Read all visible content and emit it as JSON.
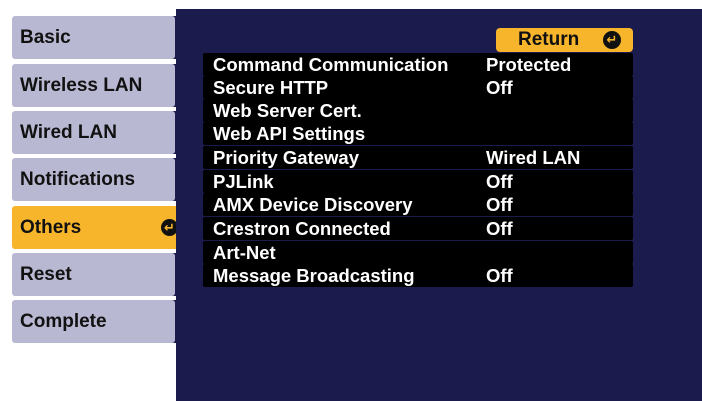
{
  "sidebar": {
    "items": [
      {
        "label": "Basic"
      },
      {
        "label": "Wireless LAN"
      },
      {
        "label": "Wired LAN"
      },
      {
        "label": "Notifications"
      },
      {
        "label": "Others",
        "active": true
      },
      {
        "label": "Reset"
      },
      {
        "label": "Complete"
      }
    ]
  },
  "main": {
    "return_label": "Return",
    "settings": [
      {
        "label": "Command Communication",
        "value": "Protected"
      },
      {
        "label": "Secure HTTP",
        "value": "Off"
      },
      {
        "label": "Web Server Cert.",
        "value": ""
      },
      {
        "label": "Web API Settings",
        "value": ""
      },
      {
        "label": "Priority Gateway",
        "value": "Wired LAN"
      },
      {
        "label": "PJLink",
        "value": "Off"
      },
      {
        "label": "AMX Device Discovery",
        "value": "Off"
      },
      {
        "label": "Crestron Connected",
        "value": "Off"
      },
      {
        "label": "Art-Net",
        "value": ""
      },
      {
        "label": "Message Broadcasting",
        "value": "Off"
      }
    ]
  },
  "colors": {
    "panel_background": "#1b1b4e",
    "tab_background": "#b9b8d2",
    "active_accent": "#f7b52b",
    "row_background": "#000000",
    "row_text": "#ffffff"
  },
  "icons": {
    "enter": "enter-icon"
  }
}
